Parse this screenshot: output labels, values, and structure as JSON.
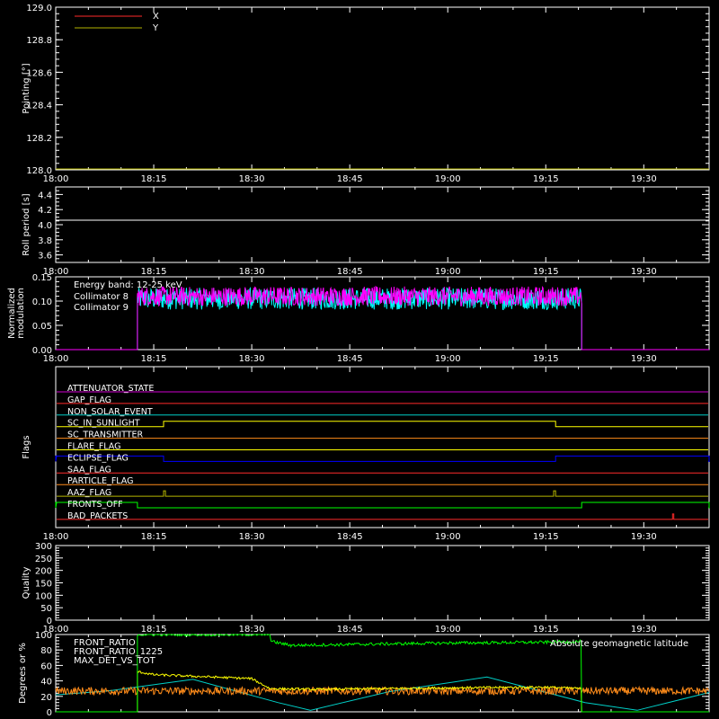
{
  "colors": {
    "background": "#000000",
    "axes": "#ffffff",
    "red": "#ff2a2a",
    "yellow": "#ffff00",
    "cyan": "#00ffff",
    "magenta": "#ff00ff",
    "green": "#00ff00",
    "orange": "#ff8c1a",
    "blue": "#0000ff",
    "olive": "#b5b500",
    "sea": "#00d0c8",
    "purple": "#d000d0"
  },
  "chart_data": [
    {
      "type": "line",
      "name": "pointing",
      "ylabel": "Pointing [°]",
      "xlim": [
        "18:00",
        "19:40"
      ],
      "ylim": [
        128.0,
        129.0
      ],
      "yticks": [
        "128.0",
        "128.2",
        "128.4",
        "128.6",
        "128.8",
        "129.0"
      ],
      "xticks": [
        "18:00",
        "18:15",
        "18:30",
        "18:45",
        "19:00",
        "19:15",
        "19:30"
      ],
      "legend_position": "top-left",
      "series": [
        {
          "name": "X",
          "color": "#ff2a2a",
          "x": [
            "18:00",
            "19:40"
          ],
          "y": [
            128.0,
            128.0
          ]
        },
        {
          "name": "Y",
          "color": "#b5b500",
          "x": [
            "18:00",
            "19:40"
          ],
          "y": [
            128.0,
            128.0
          ]
        }
      ]
    },
    {
      "type": "line",
      "name": "roll-period",
      "ylabel": "Roll period [s]",
      "xlim": [
        "18:00",
        "19:40"
      ],
      "ylim": [
        3.5,
        4.5
      ],
      "yticks": [
        "3.6",
        "3.8",
        "4.0",
        "4.2",
        "4.4"
      ],
      "xticks": [
        "18:00",
        "18:15",
        "18:30",
        "18:45",
        "19:00",
        "19:15",
        "19:30"
      ],
      "series": [
        {
          "color": "#ffffff",
          "x": [
            "18:00",
            "19:40"
          ],
          "y": [
            4.06,
            4.06
          ]
        }
      ]
    },
    {
      "type": "line",
      "name": "modulation",
      "ylabel": [
        "Normalized",
        "modulation"
      ],
      "xlim": [
        "18:00",
        "19:40"
      ],
      "ylim": [
        0.0,
        0.15
      ],
      "yticks": [
        "0.00",
        "0.05",
        "0.10",
        "0.15"
      ],
      "xticks": [
        "18:00",
        "18:15",
        "18:30",
        "18:45",
        "19:00",
        "19:15",
        "19:30"
      ],
      "legend_position": "top-left",
      "annotation": "Energy band: 12-25 keV",
      "series": [
        {
          "name": "Collimator 8",
          "color": "#00ffff",
          "active": [
            "18:12.5",
            "19:20.5"
          ],
          "level": 0.105,
          "spread": 0.045
        },
        {
          "name": "Collimator 9",
          "color": "#ff00ff",
          "active": [
            "18:12.5",
            "19:20.5"
          ],
          "level": 0.11,
          "spread": 0.04
        }
      ]
    },
    {
      "type": "line",
      "name": "flags",
      "ylabel": "Flags",
      "xlim": [
        "18:00",
        "19:40"
      ],
      "xticks": [
        "18:00",
        "18:15",
        "18:30",
        "18:45",
        "19:00",
        "19:15",
        "19:30"
      ],
      "flags": [
        {
          "label": "ATTENUATOR_STATE",
          "color": "#d000d0",
          "on": []
        },
        {
          "label": "GAP_FLAG",
          "color": "#ff2a2a",
          "on": []
        },
        {
          "label": "NON_SOLAR_EVENT",
          "color": "#00d0c8",
          "on": []
        },
        {
          "label": "SC_IN_SUNLIGHT",
          "color": "#ffff00",
          "on": [
            [
              "18:16.5",
              "19:16.5"
            ]
          ]
        },
        {
          "label": "SC_TRANSMITTER",
          "color": "#ff8c1a",
          "on": []
        },
        {
          "label": "FLARE_FLAG",
          "color": "#ffff00",
          "on": []
        },
        {
          "label": "ECLIPSE_FLAG",
          "color": "#0000ff",
          "on": [
            [
              "18:00",
              "18:16.5"
            ],
            [
              "19:16.5",
              "19:40"
            ]
          ]
        },
        {
          "label": "SAA_FLAG",
          "color": "#ff2a2a",
          "on": []
        },
        {
          "label": "PARTICLE_FLAG",
          "color": "#ff8c1a",
          "on": []
        },
        {
          "label": "AAZ_FLAG",
          "color": "#b5b500",
          "on": [
            [
              "18:16.5",
              "18:16.8"
            ],
            [
              "19:16.2",
              "19:16.5"
            ]
          ]
        },
        {
          "label": "FRONTS_OFF",
          "color": "#00ff00",
          "on": [
            [
              "18:00",
              "18:12.5"
            ],
            [
              "19:20.5",
              "19:40"
            ]
          ]
        },
        {
          "label": "BAD_PACKETS",
          "color": "#ff2a2a",
          "on": [
            [
              "19:34.4",
              "19:34.6"
            ]
          ]
        }
      ]
    },
    {
      "type": "line",
      "name": "quality",
      "ylabel": "Quality",
      "xlim": [
        "18:00",
        "19:40"
      ],
      "ylim": [
        0,
        300
      ],
      "yticks": [
        "0",
        "50",
        "100",
        "150",
        "200",
        "250",
        "300"
      ],
      "xticks": [
        "18:00",
        "18:15",
        "18:30",
        "18:45",
        "19:00",
        "19:15",
        "19:30"
      ],
      "series": []
    },
    {
      "type": "line",
      "name": "ratios",
      "ylabel": "Degrees or %",
      "xlim": [
        "18:00",
        "19:40"
      ],
      "ylim": [
        0,
        100
      ],
      "yticks": [
        "0",
        "20",
        "40",
        "60",
        "80",
        "100"
      ],
      "legend_position": "top-left",
      "annotation": "Absolute geomagnetic latitude",
      "series": [
        {
          "name": "FRONT_RATIO",
          "color": "#ffff00",
          "x": [
            "18:12.5",
            "18:15",
            "18:30",
            "18:32.8",
            "18:40",
            "19:00",
            "19:15",
            "19:20.5"
          ],
          "y": [
            52,
            48,
            43,
            30,
            29,
            31,
            32,
            30
          ]
        },
        {
          "name": "FRONT_RATIO_1225",
          "color": "#00ff00",
          "x": [
            "18:12.5",
            "18:32.8",
            "18:33",
            "18:36",
            "19:00",
            "19:15",
            "19:20.5"
          ],
          "y": [
            100,
            100,
            91,
            86,
            89,
            90,
            91
          ]
        },
        {
          "name": "MAX_DET_VS_TOT",
          "color": "#ff8c1a",
          "level": 27,
          "spread": 10
        },
        {
          "name": "Absolute geomagnetic latitude",
          "color": "#00d0c8",
          "x": [
            "18:00",
            "18:08",
            "18:21",
            "18:34",
            "18:39",
            "18:51",
            "19:06",
            "19:21",
            "19:29",
            "19:40"
          ],
          "y": [
            22,
            27,
            42,
            12,
            2,
            26,
            45,
            12,
            2,
            25
          ]
        }
      ]
    }
  ]
}
